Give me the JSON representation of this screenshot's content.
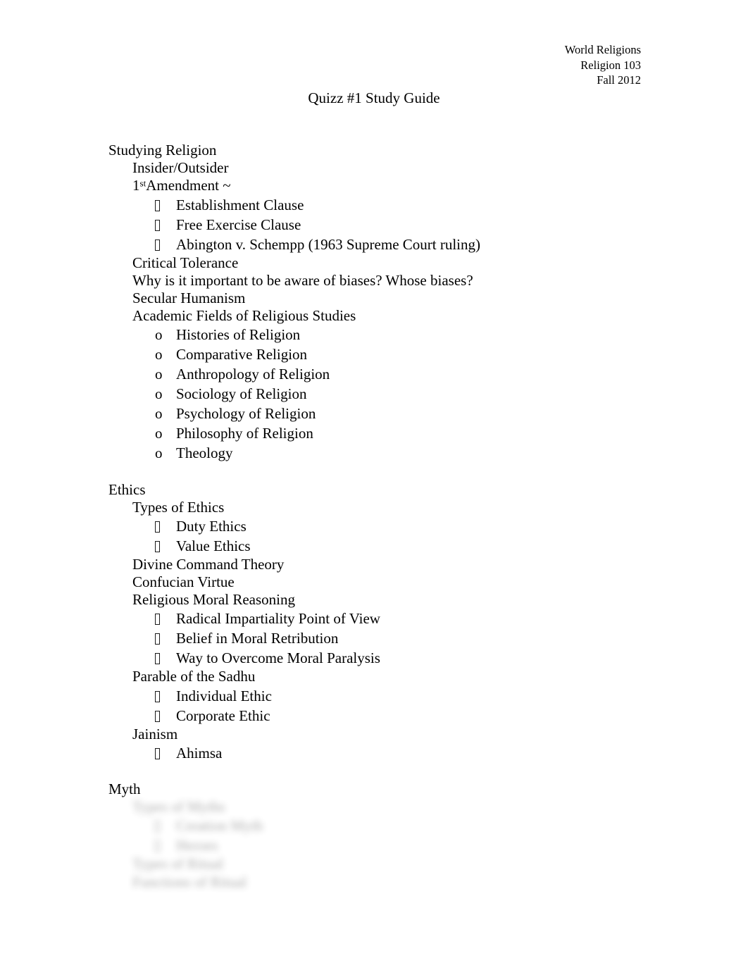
{
  "header": {
    "course_name": "World Religions",
    "course_code": "Religion 103",
    "term": "Fall 2012"
  },
  "title": "Quizz #1 Study Guide",
  "sections": [
    {
      "heading": "Studying Religion",
      "items": [
        {
          "level": 2,
          "text": "Insider/Outsider"
        },
        {
          "level": 2,
          "text": "1stAmendment ~",
          "superscript": true,
          "pre": "1",
          "sup": "st",
          "post": "Amendment ~"
        },
        {
          "level": 3,
          "marker": "tofu",
          "text": "Establishment Clause"
        },
        {
          "level": 3,
          "marker": "tofu",
          "text": "Free Exercise Clause"
        },
        {
          "level": 3,
          "marker": "tofu",
          "text": "Abington v. Schempp (1963 Supreme Court ruling)"
        },
        {
          "level": 2,
          "text": "Critical Tolerance"
        },
        {
          "level": 2,
          "text": "Why is it important to be aware of biases? Whose biases?"
        },
        {
          "level": 2,
          "text": "Secular Humanism"
        },
        {
          "level": 2,
          "text": "Academic Fields of Religious Studies"
        },
        {
          "level": 3,
          "marker": "o",
          "text": "Histories of Religion"
        },
        {
          "level": 3,
          "marker": "o",
          "text": "Comparative Religion"
        },
        {
          "level": 3,
          "marker": "o",
          "text": "Anthropology of Religion"
        },
        {
          "level": 3,
          "marker": "o",
          "text": "Sociology of Religion"
        },
        {
          "level": 3,
          "marker": "o",
          "text": "Psychology of Religion"
        },
        {
          "level": 3,
          "marker": "o",
          "text": "Philosophy of Religion"
        },
        {
          "level": 3,
          "marker": "o",
          "text": "Theology"
        }
      ]
    },
    {
      "heading": "Ethics",
      "items": [
        {
          "level": 2,
          "text": "Types of Ethics"
        },
        {
          "level": 3,
          "marker": "tofu",
          "text": "Duty Ethics"
        },
        {
          "level": 3,
          "marker": "tofu",
          "text": "Value Ethics"
        },
        {
          "level": 2,
          "text": "Divine Command Theory"
        },
        {
          "level": 2,
          "text": "Confucian Virtue"
        },
        {
          "level": 2,
          "text": "Religious Moral Reasoning"
        },
        {
          "level": 3,
          "marker": "tofu",
          "text": "Radical Impartiality Point of View"
        },
        {
          "level": 3,
          "marker": "tofu",
          "text": "Belief in Moral Retribution"
        },
        {
          "level": 3,
          "marker": "tofu",
          "text": "Way to Overcome Moral Paralysis"
        },
        {
          "level": 2,
          "text": "Parable of the Sadhu"
        },
        {
          "level": 3,
          "marker": "tofu",
          "text": "Individual Ethic"
        },
        {
          "level": 3,
          "marker": "tofu",
          "text": "Corporate Ethic"
        },
        {
          "level": 2,
          "text": "Jainism"
        },
        {
          "level": 3,
          "marker": "tofu",
          "text": "Ahimsa"
        }
      ]
    },
    {
      "heading": "Myth",
      "obscured": true,
      "items": [
        {
          "level": 2,
          "text": "Types of Myths"
        },
        {
          "level": 3,
          "marker": "tofu",
          "text": "Creation Myth"
        },
        {
          "level": 3,
          "marker": "tofu",
          "text": "Heroes"
        },
        {
          "level": 2,
          "text": "Types of Ritual"
        },
        {
          "level": 2,
          "text": "Functions of Ritual"
        }
      ]
    }
  ],
  "labels": {
    "bullet_tofu": "missing-glyph-box",
    "bullet_o": "o"
  }
}
